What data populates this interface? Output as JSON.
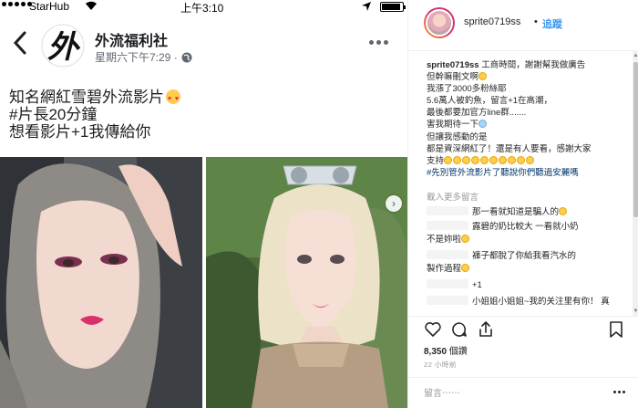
{
  "status_bar": {
    "carrier": "StarHub",
    "time": "上午3:10",
    "battery_level": 0.85
  },
  "fb_post": {
    "page_name": "外流福利社",
    "logo_text": "外",
    "timestamp": "星期六下午7:29 · ",
    "text_lines": [
      "知名網紅雪碧外流影片",
      "#片長20分鐘",
      "想看影片+1我傳給你"
    ],
    "icons": [
      "back-chevron",
      "globe",
      "more-horizontal",
      "heart-eyes-emoji",
      "carousel-next-arrow"
    ]
  },
  "instagram": {
    "username": "sprite0719ss",
    "separator": "•",
    "follow_label": "追蹤",
    "caption_user": "sprite0719ss",
    "caption_lines": [
      " 工商時間，謝謝幫我做廣告",
      "但幹嘛刪文啊",
      "我漲了3000多粉絲耶",
      "5.6萬人被釣魚，留言+1在高潮，",
      "最後都要加官方line群.......",
      "害我期待一下",
      "但讓我感動的是",
      "都是資深網紅了！還是有人要看，感謝大家",
      "支持"
    ],
    "caption_hashtag": "#先別管外流影片了聽說你們聽過安麗嗎",
    "view_earlier_label": "載入更多留言",
    "comments": [
      {
        "lines": [
          "那一看就知道是騙人的"
        ]
      },
      {
        "lines": [
          "露碧的奶比較大 一看就小奶",
          "不是妳啦"
        ]
      },
      {
        "lines": [
          "褲子都脫了你給我看汽水的",
          "製作過程"
        ]
      },
      {
        "lines": [
          "+1"
        ]
      },
      {
        "lines": [
          "小姐姐小姐姐~我的关注里有你！ 真"
        ]
      }
    ],
    "likes_count": "8,350",
    "likes_label": " 個讚",
    "time_ago": "22 小時前",
    "add_comment_placeholder": "留言⋯⋯",
    "icons": [
      "heart-icon",
      "comment-icon",
      "share-icon",
      "bookmark-icon"
    ]
  },
  "colors": {
    "ig_blue": "#3897f0",
    "hashtag": "#003569",
    "fb_gray": "#606770"
  }
}
